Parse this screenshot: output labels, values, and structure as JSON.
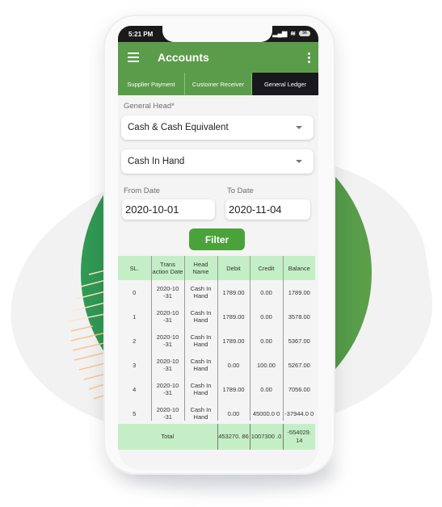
{
  "status_bar": {
    "time": "5:21 PM",
    "battery": "56"
  },
  "app_bar": {
    "title": "Accounts"
  },
  "tabs": [
    {
      "label": "Supplier Payment",
      "active": false
    },
    {
      "label": "Customer Receiver",
      "active": false
    },
    {
      "label": "General Ledger",
      "active": true
    }
  ],
  "form": {
    "general_head_label": "General Head*",
    "general_head_value": "Cash & Cash Equivalent",
    "sub_head_value": "Cash In Hand",
    "from_date_label": "From Date",
    "from_date_value": "2020-10-01",
    "to_date_label": "To Date",
    "to_date_value": "2020-11-04",
    "filter_label": "Filter"
  },
  "table": {
    "headers": [
      "SL.",
      "Trans action Date",
      "Head Name",
      "Debit",
      "Credit",
      "Balance"
    ],
    "rows": [
      [
        "0",
        "2020-10 -31",
        "Cash In Hand",
        "1789.00",
        "0.00",
        "1789.00"
      ],
      [
        "1",
        "2020-10 -31",
        "Cash In Hand",
        "1789.00",
        "0.00",
        "3578.00"
      ],
      [
        "2",
        "2020-10 -31",
        "Cash In Hand",
        "1789.00",
        "0.00",
        "5367.00"
      ],
      [
        "3",
        "2020-10 -31",
        "Cash In Hand",
        "0.00",
        "100.00",
        "5267.00"
      ],
      [
        "4",
        "2020-10 -31",
        "Cash In Hand",
        "1789.00",
        "0.00",
        "7056.00"
      ],
      [
        "5",
        "2020-10 -31",
        "Cash In Hand",
        "0.00",
        "45000.0 0",
        "-37944.0 0"
      ]
    ],
    "totals": {
      "label": "Total",
      "debit": "453270. 86",
      "credit": "1007300 .0",
      "balance": "-554029. 14"
    }
  },
  "colors": {
    "primary": "#5b9c4a",
    "active_tab": "#18181d",
    "table_header": "#c4efc6",
    "filter_button": "#4aa33a"
  }
}
